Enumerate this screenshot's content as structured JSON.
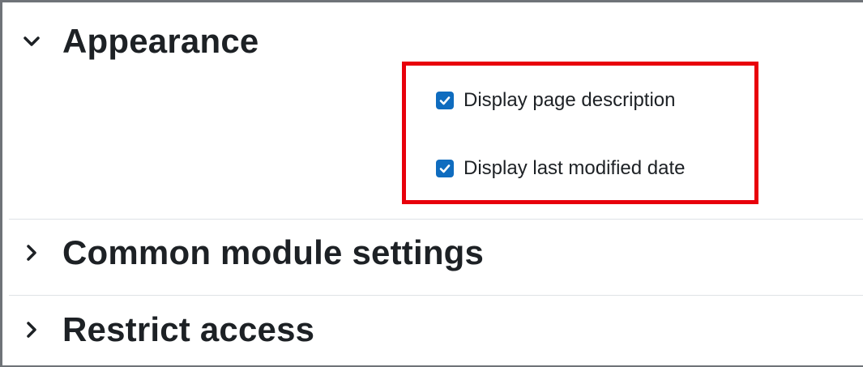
{
  "sections": [
    {
      "title": "Appearance",
      "expanded": true,
      "fields": [
        {
          "label": "Display page description",
          "checked": true
        },
        {
          "label": "Display last modified date",
          "checked": true
        }
      ]
    },
    {
      "title": "Common module settings",
      "expanded": false
    },
    {
      "title": "Restrict access",
      "expanded": false
    }
  ],
  "colors": {
    "checkbox": "#0f6cbf",
    "highlight": "#e8000b",
    "text": "#1d2125"
  },
  "icons": {
    "expanded": "chevron-down-icon",
    "collapsed": "chevron-right-icon",
    "checked": "checkmark-icon"
  }
}
